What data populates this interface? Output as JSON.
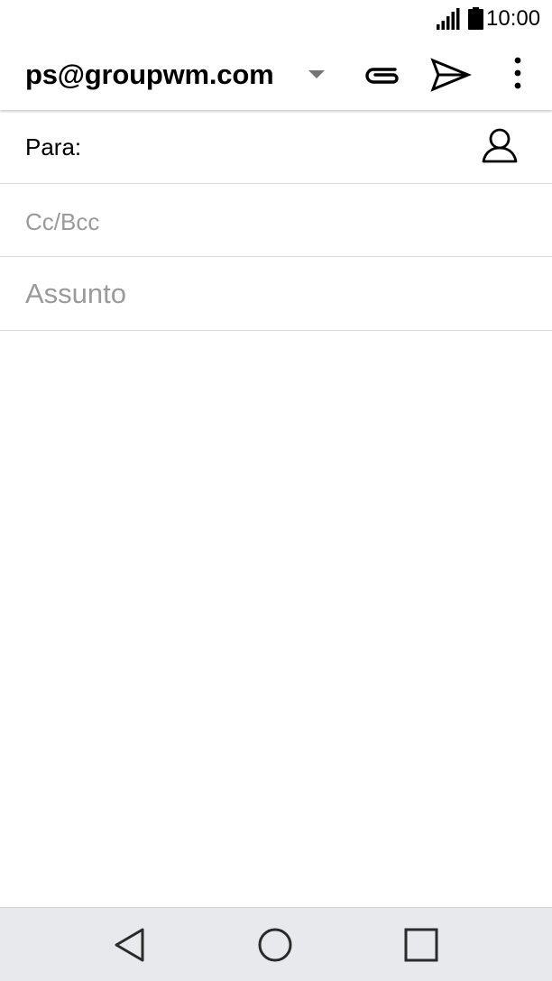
{
  "status_bar": {
    "time": "10:00",
    "signal_icon": "signal-bars-icon",
    "battery_icon": "battery-icon"
  },
  "compose": {
    "account": "ps@groupwm.com",
    "account_caret_icon": "dropdown-caret-icon",
    "attach_icon": "paperclip-icon",
    "send_icon": "send-icon",
    "more_icon": "more-vert-icon"
  },
  "fields": {
    "to_label": "Para:",
    "contact_icon": "contact-person-icon",
    "cc_placeholder": "Cc/Bcc",
    "subject_placeholder": "Assunto"
  },
  "nav_bar": {
    "back_icon": "back-triangle-icon",
    "home_icon": "home-circle-icon",
    "recent_icon": "recent-apps-square-icon"
  },
  "colors": {
    "placeholder": "#9a9a9a",
    "divider": "#dcdcdc",
    "nav_background": "#e8e9ec",
    "icon": "#000000"
  }
}
